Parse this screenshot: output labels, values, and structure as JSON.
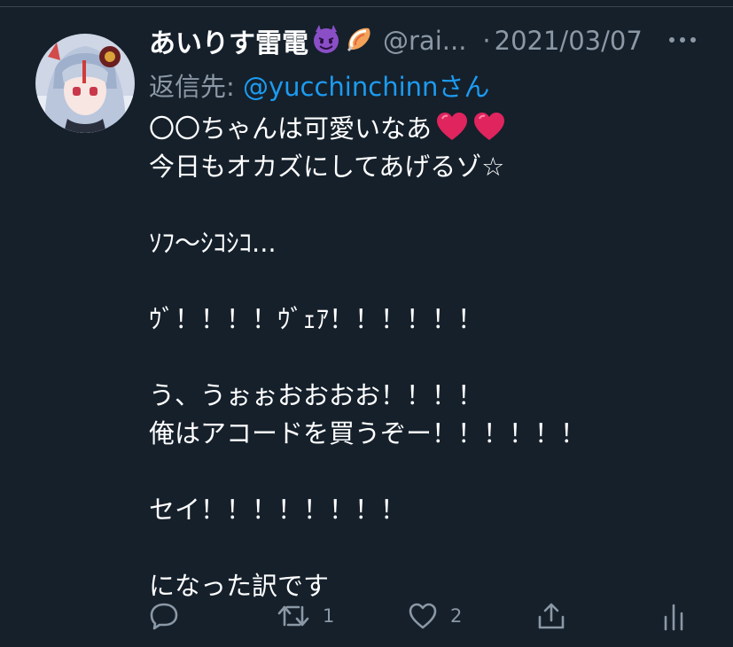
{
  "tweet": {
    "display_name": "あいりす雷電",
    "name_emojis": [
      "smiling-devil-emoji",
      "fish-cake-emoji"
    ],
    "handle": "@rai...",
    "separator": "·",
    "date": "2021/03/07",
    "reply_prefix": "返信先: ",
    "reply_to": "@yucchinchinnさん",
    "lines": [
      "〇〇ちゃんは可愛いなあ",
      "今日もオカズにしてあげるゾ☆",
      "",
      "ｿﾌ〜ｼｺｼｺ...",
      "",
      "ｳﾞ！！！！ｳﾞｪｱ！！！！！！",
      "",
      "う、うぉぉおおおお！！！！",
      "俺はアコードを買うぞー！！！！！！",
      "",
      "セイ！！！！！！！！",
      "",
      "になった訳です"
    ],
    "hearts_after_line1": 2
  },
  "actions": {
    "reply": {
      "icon": "reply-icon",
      "count": ""
    },
    "retweet": {
      "icon": "retweet-icon",
      "count": "1"
    },
    "like": {
      "icon": "like-icon",
      "count": "2"
    },
    "share": {
      "icon": "share-icon",
      "count": ""
    },
    "analytics": {
      "icon": "analytics-icon",
      "count": ""
    }
  },
  "colors": {
    "background": "#15202b",
    "text": "#ffffff",
    "muted": "#8b98a5",
    "link": "#1d9bf0",
    "heart": "#e0245e"
  }
}
